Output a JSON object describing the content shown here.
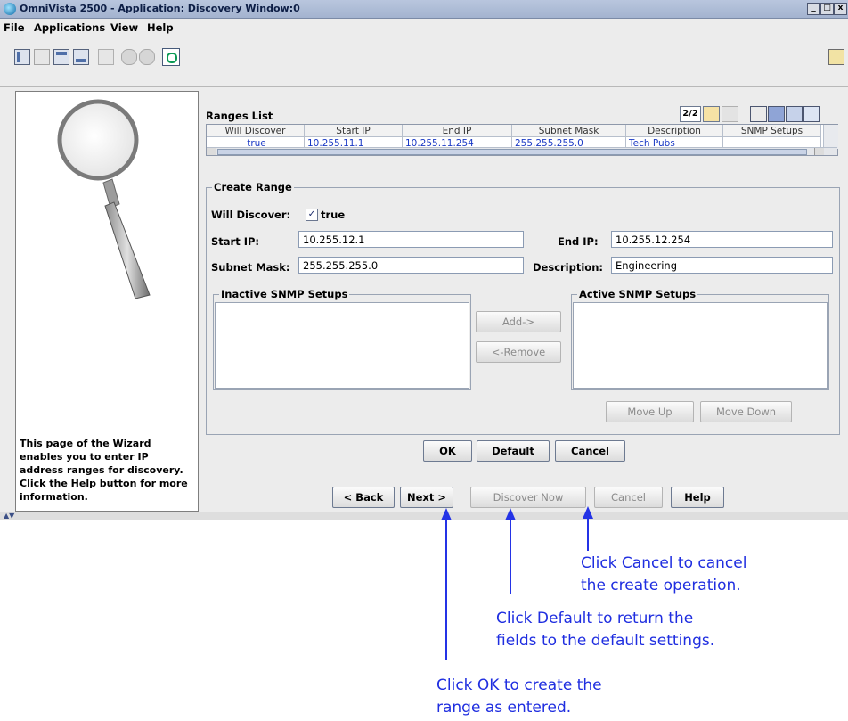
{
  "window": {
    "title": "OmniVista 2500 -  Application: Discovery  Window:0",
    "min_label": "_",
    "max_label": "□",
    "close_label": "x"
  },
  "menubar": {
    "items": [
      "File",
      "Applications",
      "View",
      "Help"
    ]
  },
  "ranges_list": {
    "title": "Ranges List",
    "page_counter": "2/2",
    "columns": [
      "Will Discover",
      "Start IP",
      "End IP",
      "Subnet Mask",
      "Description",
      "SNMP Setups"
    ],
    "rows": [
      [
        "true",
        "10.255.11.1",
        "10.255.11.254",
        "255.255.255.0",
        "Tech Pubs",
        ""
      ]
    ]
  },
  "create_range": {
    "title": "Create Range",
    "will_discover_label": "Will Discover:",
    "will_discover_value": "true",
    "start_ip_label": "Start IP:",
    "start_ip_value": "10.255.12.1",
    "end_ip_label": "End IP:",
    "end_ip_value": "10.255.12.254",
    "subnet_mask_label": "Subnet Mask:",
    "subnet_mask_value": "255.255.255.0",
    "description_label": "Description:",
    "description_value": "Engineering",
    "inactive_snmp_title": "Inactive SNMP Setups",
    "active_snmp_title": "Active SNMP Setups",
    "add_label": "Add->",
    "remove_label": "<-Remove",
    "move_up_label": "Move Up",
    "move_down_label": "Move Down"
  },
  "dialog_buttons": {
    "ok": "OK",
    "default": "Default",
    "cancel": "Cancel"
  },
  "wizard_buttons": {
    "back": "< Back",
    "next": "Next >",
    "discover_now": "Discover Now",
    "cancel": "Cancel",
    "help": "Help"
  },
  "help_text": "This page of the Wizard enables you to enter IP address ranges for discovery. Click the Help button for more information.",
  "annotations": {
    "cancel_line1": "Click Cancel to cancel",
    "cancel_line2": "the create operation.",
    "default_line1": "Click Default to return the",
    "default_line2": "fields to the default settings.",
    "ok_line1": "Click OK to create the",
    "ok_line2": "range as entered."
  },
  "colors": {
    "annotation": "#1f2ee0",
    "table_text": "#1a39c5",
    "window_bg": "#ececec"
  }
}
